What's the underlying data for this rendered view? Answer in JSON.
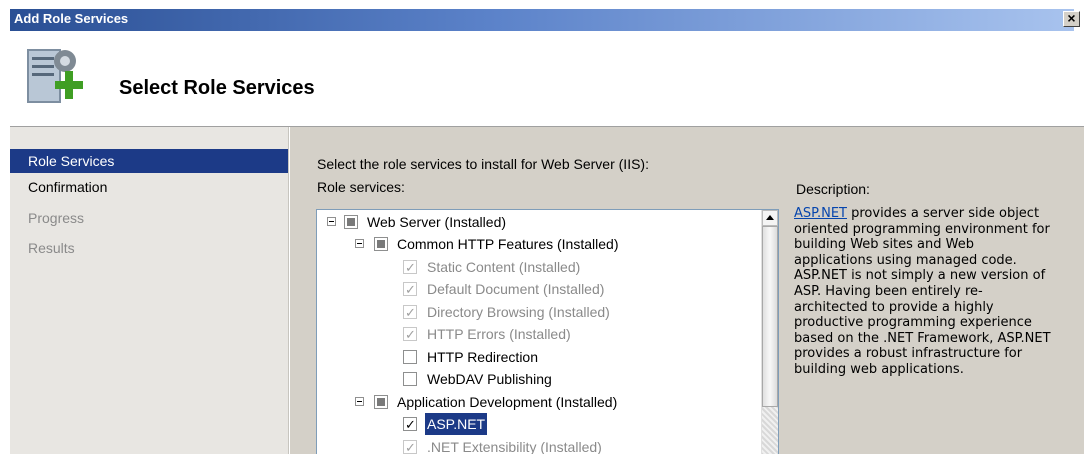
{
  "window": {
    "title": "Add Role Services",
    "close_label": "×"
  },
  "header": {
    "title": "Select Role Services"
  },
  "nav": {
    "items": [
      {
        "label": "Role Services",
        "state": "active"
      },
      {
        "label": "Confirmation",
        "state": "normal"
      },
      {
        "label": "Progress",
        "state": "disabled"
      },
      {
        "label": "Results",
        "state": "disabled"
      }
    ]
  },
  "content": {
    "instruction": "Select the role services to install for Web Server (IIS):",
    "role_services_label": "Role services:",
    "description_label": "Description:",
    "tree": [
      {
        "label": "Web Server  (Installed)",
        "level": 0,
        "state": "partial",
        "expanded": true
      },
      {
        "label": "Common HTTP Features  (Installed)",
        "level": 1,
        "state": "partial",
        "expanded": true
      },
      {
        "label": "Static Content  (Installed)",
        "level": 2,
        "state": "installed"
      },
      {
        "label": "Default Document  (Installed)",
        "level": 2,
        "state": "installed"
      },
      {
        "label": "Directory Browsing  (Installed)",
        "level": 2,
        "state": "installed"
      },
      {
        "label": "HTTP Errors  (Installed)",
        "level": 2,
        "state": "installed"
      },
      {
        "label": "HTTP Redirection",
        "level": 2,
        "state": "unchecked"
      },
      {
        "label": "WebDAV Publishing",
        "level": 2,
        "state": "unchecked"
      },
      {
        "label": "Application Development  (Installed)",
        "level": 1,
        "state": "partial",
        "expanded": true
      },
      {
        "label": "ASP.NET",
        "level": 2,
        "state": "checked",
        "selected": true
      },
      {
        "label": ".NET Extensibility  (Installed)",
        "level": 2,
        "state": "installed"
      }
    ],
    "description": {
      "link": "ASP.NET",
      "text": " provides a server side object oriented programming environment for building Web sites and Web applications using managed code. ASP.NET is not simply a new version of ASP. Having been entirely re-architected to provide a highly productive programming experience based on the .NET Framework, ASP.NET provides a robust infrastructure for building web applications."
    }
  },
  "colors": {
    "accent": "#1c3a87",
    "link": "#0645ad",
    "panel_bg": "#d4d0c8"
  }
}
